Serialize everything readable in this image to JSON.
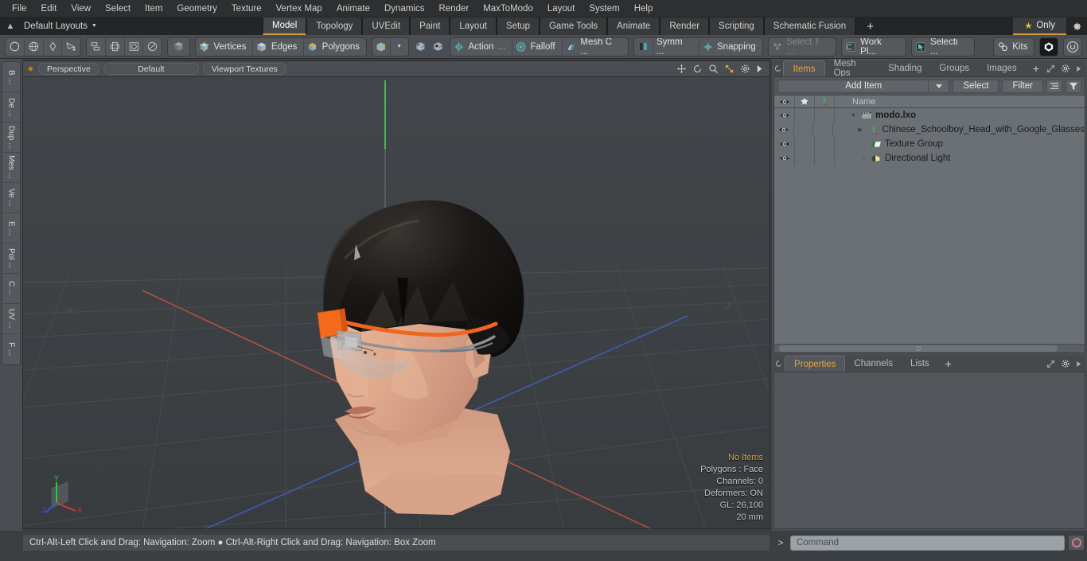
{
  "menu": {
    "items": [
      "File",
      "Edit",
      "View",
      "Select",
      "Item",
      "Geometry",
      "Texture",
      "Vertex Map",
      "Animate",
      "Dynamics",
      "Render",
      "MaxToModo",
      "Layout",
      "System",
      "Help"
    ]
  },
  "layout_bar": {
    "layout_name": "Default Layouts",
    "up_arrow": "▲",
    "caret": "▼",
    "tabs": [
      {
        "label": "Model",
        "active": true
      },
      {
        "label": "Topology",
        "active": false
      },
      {
        "label": "UVEdit",
        "active": false
      },
      {
        "label": "Paint",
        "active": false
      },
      {
        "label": "Layout",
        "active": false
      },
      {
        "label": "Setup",
        "active": false
      },
      {
        "label": "Game Tools",
        "active": false
      },
      {
        "label": "Animate",
        "active": false
      },
      {
        "label": "Render",
        "active": false
      },
      {
        "label": "Scripting",
        "active": false
      },
      {
        "label": "Schematic Fusion",
        "active": false
      }
    ],
    "add_tab": "+",
    "only_label": "Only",
    "star": "★"
  },
  "toolbar": {
    "primitives": [
      "circle-icon",
      "globe-icon",
      "pen-icon",
      "curve-icon"
    ],
    "arrange": [
      "array-icon",
      "mirror-icon",
      "boolean-icon",
      "slice-icon"
    ],
    "item_mode": "cube-gray-icon",
    "components": [
      {
        "label": "Vertices",
        "icon": "cube-vertices-icon"
      },
      {
        "label": "Edges",
        "icon": "cube-edges-icon"
      },
      {
        "label": "Polygons",
        "icon": "cube-polygons-icon"
      }
    ],
    "dropdown_caret": "▼",
    "modifiers": [
      {
        "label": "Action",
        "icon": "action-center-icon",
        "ellipsis": "..."
      },
      {
        "label": "Falloff",
        "icon": "falloff-icon",
        "ellipsis": ""
      },
      {
        "label": "Mesh C ...",
        "icon": "mesh-constraint-icon",
        "ellipsis": ""
      }
    ],
    "symmetry": {
      "label": "Symm ...",
      "icon": "symmetry-icon"
    },
    "snapping": {
      "label": "Snapping",
      "icon": "snapping-icon"
    },
    "select_through": {
      "label": "Select T ...",
      "icon": "select-through-icon",
      "disabled": true
    },
    "work_plane": {
      "label": "Work Pl...",
      "icon": "work-plane-icon"
    },
    "selection": {
      "label": "Selecti ...",
      "icon": "selection-arrow-icon"
    },
    "kits": {
      "label": "Kits",
      "icon": "gears-icon"
    },
    "unity_icon": "unity-icon",
    "unreal_icon": "unreal-icon"
  },
  "left_strip": {
    "tabs": [
      "B ...",
      "De ...",
      "Dup ...",
      "Mes ...",
      "Ve ...",
      "E ...",
      "Pol ...",
      "C ...",
      "UV ...",
      "F ..."
    ]
  },
  "viewport": {
    "dot": "●",
    "view_mode": "Perspective",
    "shading_style": "Default",
    "display_mode": "Viewport Textures",
    "header_icons": [
      "move-icon",
      "rotate-icon",
      "zoom-icon",
      "fit-icon",
      "gear-icon",
      "play-icon"
    ],
    "axis_neg_x": "-X",
    "axis_neg_z": "-Z",
    "gizmo": {
      "x": "X",
      "y": "Y",
      "z": "Z"
    },
    "info": {
      "selection": "No Items",
      "polygons": "Polygons : Face",
      "channels": "Channels: 0",
      "deformers": "Deformers: ON",
      "gl": "GL: 26,100",
      "units": "20 mm"
    }
  },
  "item_panel": {
    "tabs": [
      {
        "label": "Items",
        "active": true
      },
      {
        "label": "Mesh Ops",
        "active": false
      },
      {
        "label": "Shading",
        "active": false
      },
      {
        "label": "Groups",
        "active": false
      },
      {
        "label": "Images",
        "active": false
      }
    ],
    "add_tab": "+",
    "add_item_label": "Add Item",
    "select_label": "Select",
    "filter_label": "Filter",
    "column_headers": [
      "eye-icon",
      "add-icon",
      "axis-icon",
      "Name"
    ],
    "name_header": "Name",
    "rows": [
      {
        "name": "modo.lxo",
        "icon": "scene-clapper-icon",
        "indent": 0,
        "expander": "▼",
        "bold": true
      },
      {
        "name": "Chinese_Schoolboy_Head_with_Google_Glasses",
        "icon": "mesh-axis-icon",
        "indent": 1,
        "expander": "▶",
        "bold": false
      },
      {
        "name": "Texture Group",
        "icon": "folder-texture-icon",
        "indent": 1,
        "expander": "",
        "bold": false
      },
      {
        "name": "Directional Light",
        "icon": "light-icon",
        "indent": 1,
        "expander": "",
        "bold": false
      }
    ]
  },
  "properties_panel": {
    "tabs": [
      {
        "label": "Properties",
        "active": true
      },
      {
        "label": "Channels",
        "active": false
      },
      {
        "label": "Lists",
        "active": false
      }
    ],
    "add_tab": "+"
  },
  "status_bar": {
    "text": "Ctrl-Alt-Left Click and Drag: Navigation: Zoom ● Ctrl-Alt-Right Click and Drag: Navigation: Box Zoom"
  },
  "command_bar": {
    "prompt": ">",
    "placeholder": "Command",
    "value": "",
    "record_icon": "record-icon"
  },
  "colors": {
    "accent_orange": "#e8a33d",
    "tab_underline": "#d09a3c",
    "panel_bg": "#4a4e52",
    "tree_bg": "#6b7074",
    "viewport_bg": "#3e4245"
  }
}
